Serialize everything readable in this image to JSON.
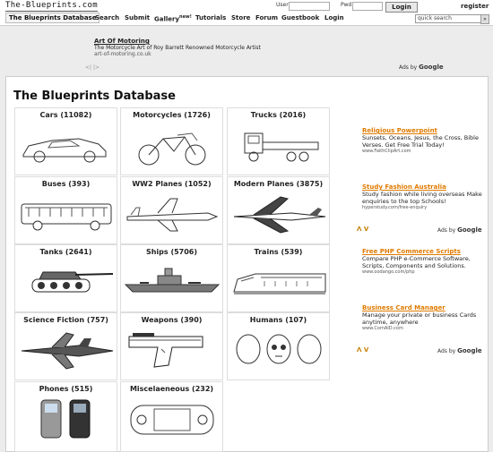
{
  "header": {
    "logo": "The-Blueprints.com",
    "user_label": "User",
    "pwd_label": "Pwd",
    "login_label": "Login",
    "register_label": "register",
    "search_placeholder": "quick search",
    "search_button": "»"
  },
  "nav": [
    "The Blueprints Database",
    "Search",
    "Submit",
    "Gallery",
    "Tutorials",
    "Store",
    "Forum",
    "Guestbook",
    "Login"
  ],
  "nav_gallery_badge": "new!",
  "top_ad": {
    "title": "Art Of Motoring",
    "desc": "The Motorcycle Art of Roy Barrett Renowned Motorcycle Artist",
    "url": "art-of-motoring.co.uk",
    "arrows": "<| |>",
    "ads_by": "Ads by",
    "google": "Google"
  },
  "page_title": "The Blueprints Database",
  "categories": [
    {
      "name": "Cars",
      "count": "(11082)",
      "icon": "car-icon"
    },
    {
      "name": "Motorcycles",
      "count": "(1726)",
      "icon": "motorcycle-icon"
    },
    {
      "name": "Trucks",
      "count": "(2016)",
      "icon": "truck-icon"
    },
    {
      "name": "Buses",
      "count": "(393)",
      "icon": "bus-icon"
    },
    {
      "name": "WW2 Planes",
      "count": "(1052)",
      "icon": "ww2-plane-icon"
    },
    {
      "name": "Modern Planes",
      "count": "(3875)",
      "icon": "jet-icon"
    },
    {
      "name": "Tanks",
      "count": "(2641)",
      "icon": "tank-icon"
    },
    {
      "name": "Ships",
      "count": "(5706)",
      "icon": "ship-icon"
    },
    {
      "name": "Trains",
      "count": "(539)",
      "icon": "train-icon"
    },
    {
      "name": "Science Fiction",
      "count": "(757)",
      "icon": "spaceship-icon"
    },
    {
      "name": "Weapons",
      "count": "(390)",
      "icon": "pistol-icon"
    },
    {
      "name": "Humans",
      "count": "(107)",
      "icon": "skull-icon"
    },
    {
      "name": "Phones",
      "count": "(515)",
      "icon": "phone-icon"
    },
    {
      "name": "Miscelaeneous",
      "count": "(232)",
      "icon": "game-console-icon"
    }
  ],
  "side_ads": [
    {
      "title": "Religious Powerpoint",
      "desc": "Sunsets, Oceans, Jesus, the Cross, Bible Verses. Get Free Trial Today!",
      "url": "www.FaithClipArt.com"
    },
    {
      "title": "Study Fashion Australia",
      "desc": "Study fashion while living overseas Make enquiries to the top Schools!",
      "url": "hyperstudy.com/free-enquiry"
    },
    {
      "title": "Free PHP Commerce Scripts",
      "desc": "Compare PHP e-Commerce Software, Scripts, Components and Solutions.",
      "url": "www.oodango.com/php"
    },
    {
      "title": "Business Card Manager",
      "desc": "Manage your private or business Cards anytime, anywhere",
      "url": "www.ComAID.com"
    }
  ],
  "side_ad_nav": "Λ V",
  "colors": {
    "accent": "#e07b00",
    "background": "#ececec"
  }
}
